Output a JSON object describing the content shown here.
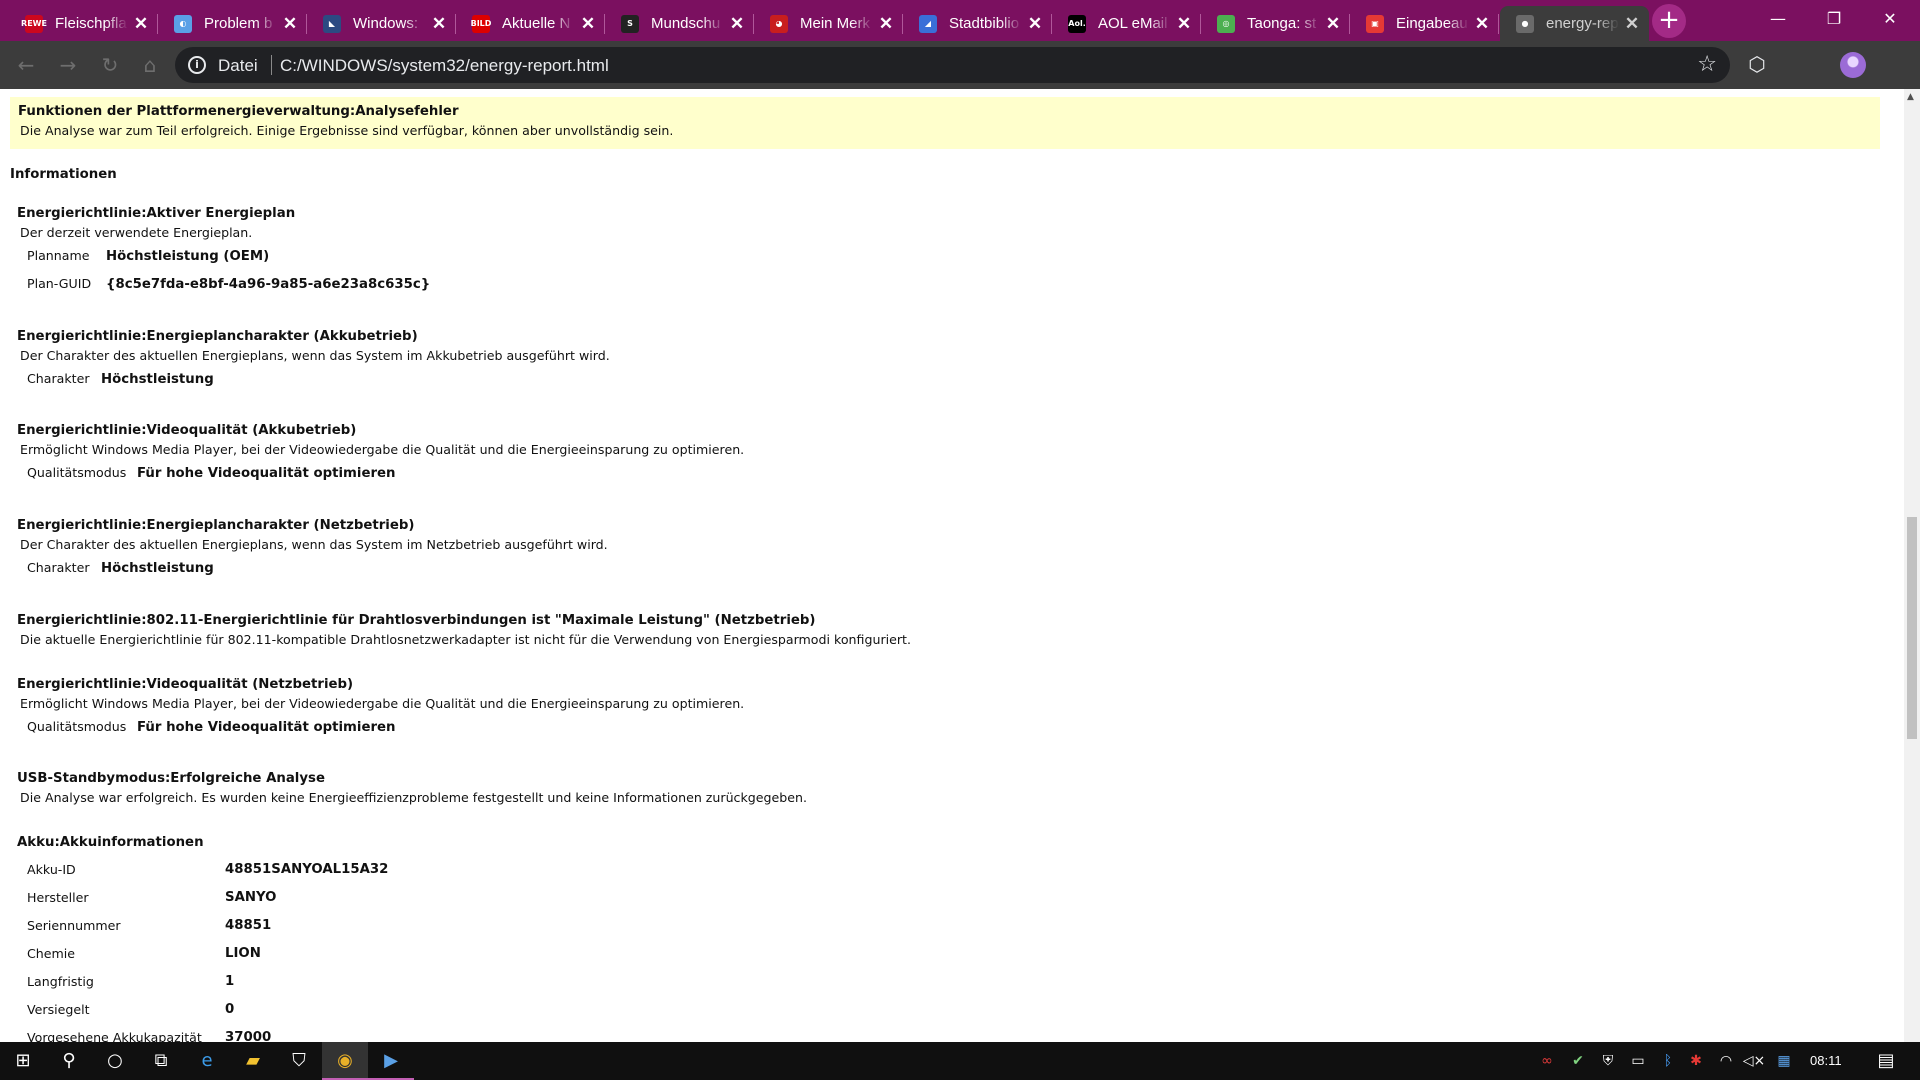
{
  "browser": {
    "tabs": [
      {
        "favicon": "rewe-icon",
        "favicon_text": "REWE",
        "favicon_color": "#cc071e",
        "title": "Fleischpfla"
      },
      {
        "favicon": "globe-icon",
        "favicon_text": "◐",
        "favicon_color": "#5aa0e6",
        "title": "Problem b"
      },
      {
        "favicon": "windows-feather-icon",
        "favicon_text": "◣",
        "favicon_color": "#2c4a82",
        "title": "Windows:"
      },
      {
        "favicon": "bild-icon",
        "favicon_text": "BILD",
        "favicon_color": "#dd0000",
        "title": "Aktuelle N"
      },
      {
        "favicon": "s-letter-icon",
        "favicon_text": "S",
        "favicon_color": "#222222",
        "title": "Mundschu"
      },
      {
        "favicon": "merkur-icon",
        "favicon_text": "◕",
        "favicon_color": "#c81e1e",
        "title": "Mein Merk"
      },
      {
        "favicon": "stadtbibliothek-icon",
        "favicon_text": "◢",
        "favicon_color": "#3a6fd8",
        "title": "Stadtbiblio"
      },
      {
        "favicon": "aol-icon",
        "favicon_text": "Aol.",
        "favicon_color": "#000000",
        "title": "AOL eMail"
      },
      {
        "favicon": "taonga-icon",
        "favicon_text": "◎",
        "favicon_color": "#4caf50",
        "title": "Taonga: st"
      },
      {
        "favicon": "eingabe-icon",
        "favicon_text": "▣",
        "favicon_color": "#e53935",
        "title": "Eingabeau"
      },
      {
        "favicon": "globe-grey-icon",
        "favicon_text": "●",
        "favicon_color": "#6a6a6a",
        "title": "energy-rep",
        "active": true
      }
    ],
    "new_tab": "+",
    "window_controls": {
      "minimize": "—",
      "maximize": "❐",
      "close": "✕"
    },
    "address": {
      "scheme_label": "Datei",
      "url": "C:/WINDOWS/system32/energy-report.html"
    }
  },
  "report": {
    "warning": {
      "title": "Funktionen der Plattformenergieverwaltung:Analysefehler",
      "description": "Die Analyse war zum Teil erfolgreich. Einige Ergebnisse sind verfügbar, können aber unvollständig sein."
    },
    "section_title": "Informationen",
    "entries": [
      {
        "title": "Energierichtlinie:Aktiver Energieplan",
        "description": "Der derzeit verwendete Energieplan.",
        "fields": [
          {
            "label": "Planname",
            "value": "Höchstleistung (OEM)"
          },
          {
            "label": "Plan-GUID",
            "value": "{8c5e7fda-e8bf-4a96-9a85-a6e23a8c635c}"
          }
        ]
      },
      {
        "title": "Energierichtlinie:Energieplancharakter (Akkubetrieb)",
        "description": "Der Charakter des aktuellen Energieplans, wenn das System im Akkubetrieb ausgeführt wird.",
        "fields": [
          {
            "label": "Charakter",
            "value": "Höchstleistung"
          }
        ]
      },
      {
        "title": "Energierichtlinie:Videoqualität (Akkubetrieb)",
        "description": "Ermöglicht Windows Media Player, bei der Videowiedergabe die Qualität und die Energieeinsparung zu optimieren.",
        "fields": [
          {
            "label": "Qualitätsmodus",
            "value": "Für hohe Videoqualität optimieren"
          }
        ]
      },
      {
        "title": "Energierichtlinie:Energieplancharakter (Netzbetrieb)",
        "description": "Der Charakter des aktuellen Energieplans, wenn das System im Netzbetrieb ausgeführt wird.",
        "fields": [
          {
            "label": "Charakter",
            "value": "Höchstleistung"
          }
        ]
      },
      {
        "title": "Energierichtlinie:802.11-Energierichtlinie für Drahtlosverbindungen ist \"Maximale Leistung\" (Netzbetrieb)",
        "description": "Die aktuelle Energierichtlinie für 802.11-kompatible Drahtlosnetzwerkadapter ist nicht für die Verwendung von Energiesparmodi konfiguriert.",
        "fields": []
      },
      {
        "title": "Energierichtlinie:Videoqualität (Netzbetrieb)",
        "description": "Ermöglicht Windows Media Player, bei der Videowiedergabe die Qualität und die Energieeinsparung zu optimieren.",
        "fields": [
          {
            "label": "Qualitätsmodus",
            "value": "Für hohe Videoqualität optimieren"
          }
        ]
      },
      {
        "title": "USB-Standbymodus:Erfolgreiche Analyse",
        "description": "Die Analyse war erfolgreich. Es wurden keine Energieeffizienzprobleme festgestellt und keine Informationen zurückgegeben.",
        "fields": []
      }
    ],
    "battery": {
      "title": "Akku:Akkuinformationen",
      "fields": [
        {
          "label": "Akku-ID",
          "value": "48851SANYOAL15A32"
        },
        {
          "label": "Hersteller",
          "value": "SANYO"
        },
        {
          "label": "Seriennummer",
          "value": "48851"
        },
        {
          "label": "Chemie",
          "value": "LION"
        },
        {
          "label": "Langfristig",
          "value": "1"
        },
        {
          "label": "Versiegelt",
          "value": "0"
        },
        {
          "label": "Vorgesehene Akkukapazität",
          "value": "37000"
        }
      ]
    }
  },
  "taskbar": {
    "apps": [
      {
        "name": "start-button",
        "glyph": "⊞"
      },
      {
        "name": "search-button",
        "glyph": "⚲"
      },
      {
        "name": "cortana-button",
        "glyph": "○"
      },
      {
        "name": "task-view-button",
        "glyph": "⧉"
      },
      {
        "name": "edge-app",
        "glyph": "e",
        "color": "#3c9be8"
      },
      {
        "name": "explorer-app",
        "glyph": "▰",
        "color": "#f2c230"
      },
      {
        "name": "store-app",
        "glyph": "⛉"
      },
      {
        "name": "chrome-app",
        "glyph": "◉",
        "color": "#e8b028",
        "open": true,
        "active": true
      },
      {
        "name": "powershell-app",
        "glyph": "▶",
        "color": "#5aa0e6",
        "open": true
      }
    ],
    "tray": [
      {
        "name": "infinity-icon",
        "glyph": "∞",
        "color": "#e23b3b"
      },
      {
        "name": "security-icon",
        "glyph": "✔",
        "color": "#7fd27f"
      },
      {
        "name": "defender-shield-icon",
        "glyph": "⛨",
        "color": "#ffffff"
      },
      {
        "name": "battery-icon",
        "glyph": "▭",
        "color": "#ffffff"
      },
      {
        "name": "bluetooth-icon",
        "glyph": "ᛒ",
        "color": "#4aa3ff"
      },
      {
        "name": "antivirus-icon",
        "glyph": "✱",
        "color": "#e53935"
      },
      {
        "name": "wifi-icon",
        "glyph": "◠",
        "color": "#ffffff"
      },
      {
        "name": "volume-muted-icon",
        "glyph": "◁×",
        "color": "#ffffff"
      },
      {
        "name": "keyboard-icon",
        "glyph": "▦",
        "color": "#5aa0e6"
      }
    ],
    "clock": "08:11",
    "notification_glyph": "▤"
  }
}
